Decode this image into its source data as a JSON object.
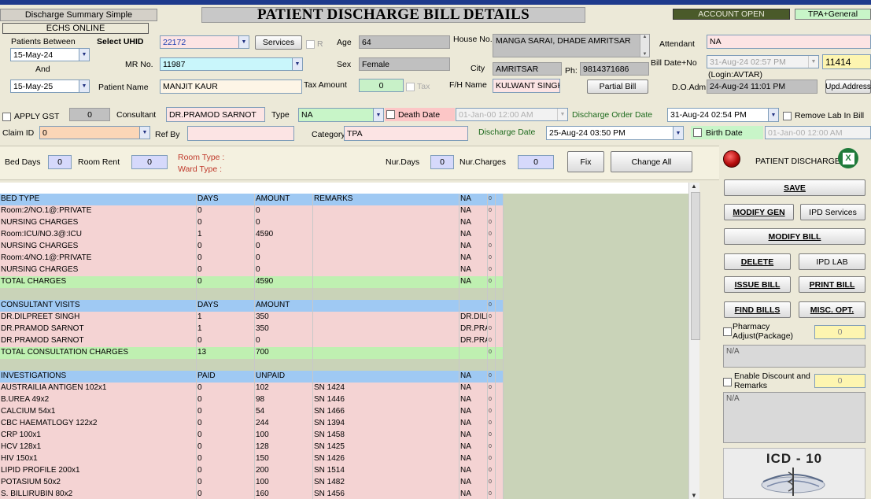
{
  "header": {
    "app_button": "Discharge Summary Simple",
    "echs": "ECHS ONLINE",
    "title": "PATIENT DISCHARGE BILL DETAILS",
    "account_status": "ACCOUNT OPEN",
    "tpa_general": "TPA+General"
  },
  "filters": {
    "patients_between_label": "Patients Between",
    "from_date": "15-May-24",
    "and_label": "And",
    "to_date": "15-May-25",
    "select_uhid_label": "Select UHID",
    "uhid_value": "22172",
    "services_button": "Services",
    "r_label": "R",
    "mr_no_label": "MR No.",
    "mr_no_value": "11987",
    "patient_name_label": "Patient Name",
    "patient_name_value": "MANJIT KAUR"
  },
  "patient": {
    "age_label": "Age",
    "age_value": "64",
    "sex_label": "Sex",
    "sex_value": "Female",
    "tax_amount_label": "Tax Amount",
    "tax_amount_value": "0",
    "tax_label": "Tax",
    "house_no_label": "House No.",
    "house_no_value": "MANGA SARAI, DHADE AMRITSAR",
    "city_label": "City",
    "city_value": "AMRITSAR",
    "ph_label": "Ph:",
    "ph_value": "9814371686",
    "fh_name_label": "F/H Name",
    "fh_name_value": "KULWANT SINGH",
    "partial_bill_button": "Partial Bill",
    "attendant_label": "Attendant",
    "attendant_value": "NA",
    "bill_date_label": "Bill Date+No",
    "bill_date_value": "31-Aug-24 02:57 PM",
    "bill_no_value": "11414",
    "login_text": "(Login:AVTAR)",
    "doadm_label": "D.O.Adm.",
    "doadm_value": "24-Aug-24 11:01 PM",
    "upd_address_button": "Upd.Address"
  },
  "row2": {
    "apply_gst_label": "APPLY GST",
    "gst_value": "0",
    "consultant_label": "Consultant",
    "consultant_value": "DR.PRAMOD SARNOT",
    "type_label": "Type",
    "type_value": "NA",
    "death_date_label": "Death Date",
    "death_date_value": "01-Jan-00 12:00 AM",
    "discharge_order_label": "Discharge Order Date",
    "discharge_order_value": "31-Aug-24 02:54 PM",
    "remove_lab_label": "Remove Lab In Bill",
    "claim_id_label": "Claim ID",
    "claim_id_value": "0",
    "ref_by_label": "Ref By",
    "ref_by_value": "",
    "category_label": "Category",
    "category_value": "TPA",
    "discharge_date_label": "Discharge Date",
    "discharge_date_value": "25-Aug-24 03:50 PM",
    "birth_date_label": "Birth Date",
    "birth_date_value": "01-Jan-00 12:00 AM"
  },
  "band": {
    "bed_days_label": "Bed Days",
    "bed_days_value": "0",
    "room_rent_label": "Room Rent",
    "room_rent_value": "0",
    "room_type_label": "Room Type :",
    "ward_type_label": "Ward Type :",
    "nur_days_label": "Nur.Days",
    "nur_days_value": "0",
    "nur_charges_label": "Nur.Charges",
    "nur_charges_value": "0",
    "fix_button": "Fix",
    "change_all_button": "Change All"
  },
  "status": {
    "patient_discharged": "PATIENT DISCHARGED",
    "indicator_color": "#d0111b"
  },
  "actions": {
    "save": "SAVE",
    "modify_gen": "MODIFY GEN",
    "ipd_services": "IPD Services",
    "modify_bill": "MODIFY BILL",
    "delete": "DELETE",
    "ipd_lab": "IPD LAB",
    "issue_bill": "ISSUE BILL",
    "print_bill": "PRINT BILL",
    "find_bills": "FIND BILLS",
    "misc_opt": "MISC. OPT.",
    "pharmacy_adjust_label": "Pharmacy Adjust(Package)",
    "pharmacy_adjust_value": "0",
    "pharmacy_note": "N/A",
    "enable_discount_label": "Enable Discount and Remarks",
    "discount_value": "0",
    "discount_note": "N/A",
    "icd_logo_text": "ICD - 10"
  },
  "colors": {
    "header_row": "#9fc9f3",
    "item_row": "#f4d3d3",
    "total_row": "#bff0b1",
    "spacer_row": "#c9d3b8"
  },
  "grid_rows": [
    {
      "type": "header",
      "cells": [
        "BED TYPE",
        "DAYS",
        "AMOUNT",
        "REMARKS",
        "NA",
        "0",
        ""
      ]
    },
    {
      "type": "item",
      "cells": [
        "Room:2/NO.1@:PRIVATE",
        "0",
        "0",
        "",
        "NA",
        "0",
        ""
      ]
    },
    {
      "type": "item",
      "cells": [
        "NURSING CHARGES",
        "0",
        "0",
        "",
        "NA",
        "0",
        ""
      ]
    },
    {
      "type": "item",
      "cells": [
        "Room:ICU/NO.3@:ICU",
        "1",
        "4590",
        "",
        "NA",
        "0",
        ""
      ]
    },
    {
      "type": "item",
      "cells": [
        "NURSING CHARGES",
        "0",
        "0",
        "",
        "NA",
        "0",
        ""
      ]
    },
    {
      "type": "item",
      "cells": [
        "Room:4/NO.1@:PRIVATE",
        "0",
        "0",
        "",
        "NA",
        "0",
        ""
      ]
    },
    {
      "type": "item",
      "cells": [
        "NURSING CHARGES",
        "0",
        "0",
        "",
        "NA",
        "0",
        ""
      ]
    },
    {
      "type": "total",
      "cells": [
        "TOTAL CHARGES",
        "0",
        "4590",
        "",
        "NA",
        "0",
        ""
      ]
    },
    {
      "type": "spacer",
      "cells": [
        "",
        "",
        "",
        "",
        "",
        "",
        ""
      ]
    },
    {
      "type": "header",
      "cells": [
        "CONSULTANT VISITS",
        "DAYS",
        "AMOUNT",
        "",
        "",
        "0",
        ""
      ]
    },
    {
      "type": "item",
      "cells": [
        "DR.DILPREET SINGH",
        "1",
        "350",
        "",
        "DR.DILPI",
        "0",
        ""
      ]
    },
    {
      "type": "item",
      "cells": [
        "DR.PRAMOD SARNOT",
        "1",
        "350",
        "",
        "DR.PRAN",
        "0",
        ""
      ]
    },
    {
      "type": "item",
      "cells": [
        "DR.PRAMOD SARNOT",
        "0",
        "0",
        "",
        "DR.PRAN",
        "0",
        ""
      ]
    },
    {
      "type": "total",
      "cells": [
        "TOTAL CONSULTATION CHARGES",
        "13",
        "700",
        "",
        "",
        "0",
        ""
      ]
    },
    {
      "type": "spacer",
      "cells": [
        "",
        "",
        "",
        "",
        "",
        "",
        ""
      ]
    },
    {
      "type": "header",
      "cells": [
        "INVESTIGATIONS",
        "PAID",
        "UNPAID",
        "",
        "NA",
        "0",
        ""
      ]
    },
    {
      "type": "item",
      "cells": [
        "AUSTRAILIA ANTIGEN  102x1",
        "0",
        "102",
        "SN 1424",
        "NA",
        "0",
        ""
      ]
    },
    {
      "type": "item",
      "cells": [
        "B.UREA  49x2",
        "0",
        "98",
        "SN 1446",
        "NA",
        "0",
        ""
      ]
    },
    {
      "type": "item",
      "cells": [
        "CALCIUM  54x1",
        "0",
        "54",
        "SN 1466",
        "NA",
        "0",
        ""
      ]
    },
    {
      "type": "item",
      "cells": [
        "CBC HAEMATLOGY  122x2",
        "0",
        "244",
        "SN 1394",
        "NA",
        "0",
        ""
      ]
    },
    {
      "type": "item",
      "cells": [
        "CRP  100x1",
        "0",
        "100",
        "SN 1458",
        "NA",
        "0",
        ""
      ]
    },
    {
      "type": "item",
      "cells": [
        "HCV  128x1",
        "0",
        "128",
        "SN 1425",
        "NA",
        "0",
        ""
      ]
    },
    {
      "type": "item",
      "cells": [
        "HIV  150x1",
        "0",
        "150",
        "SN 1426",
        "NA",
        "0",
        ""
      ]
    },
    {
      "type": "item",
      "cells": [
        "LIPID PROFILE  200x1",
        "0",
        "200",
        "SN 1514",
        "NA",
        "0",
        ""
      ]
    },
    {
      "type": "item",
      "cells": [
        "POTASIUM  50x2",
        "0",
        "100",
        "SN 1482",
        "NA",
        "0",
        ""
      ]
    },
    {
      "type": "item",
      "cells": [
        "S. BILLIRUBIN  80x2",
        "0",
        "160",
        "SN 1456",
        "NA",
        "0",
        ""
      ]
    }
  ]
}
